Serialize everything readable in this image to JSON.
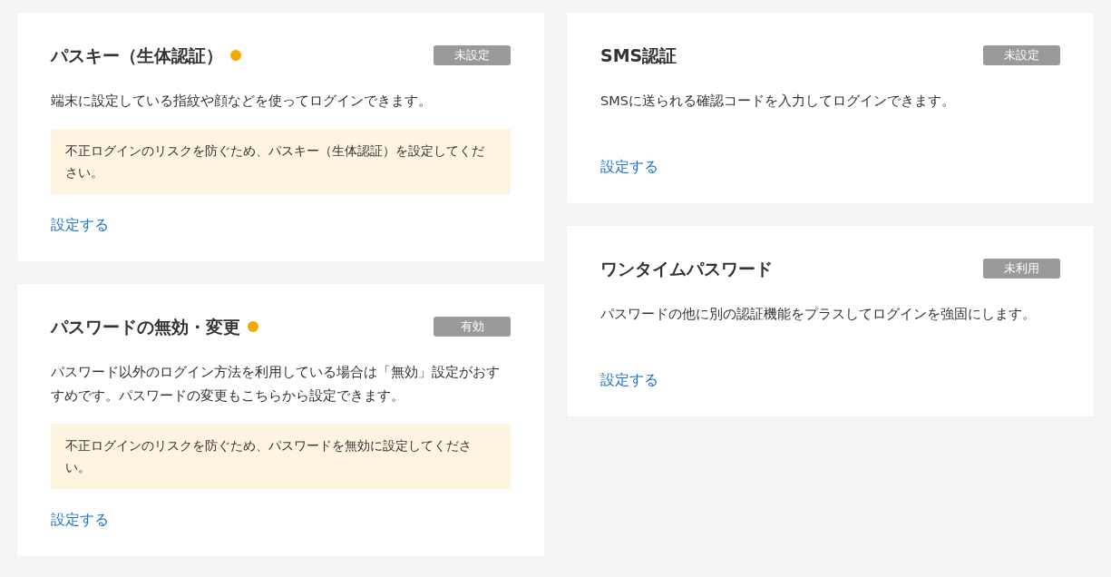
{
  "columns": [
    {
      "cards": [
        {
          "title": "パスキー（生体認証）",
          "attention": true,
          "status": "未設定",
          "description": "端末に設定している指紋や顔などを使ってログインできます。",
          "warning": "不正ログインのリスクを防ぐため、パスキー（生体認証）を設定してください。",
          "link": "設定する"
        },
        {
          "title": "パスワードの無効・変更",
          "attention": true,
          "status": "有効",
          "description": "パスワード以外のログイン方法を利用している場合は「無効」設定がおすすめです。パスワードの変更もこちらから設定できます。",
          "warning": "不正ログインのリスクを防ぐため、パスワードを無効に設定してください。",
          "link": "設定する"
        }
      ]
    },
    {
      "cards": [
        {
          "title": "SMS認証",
          "attention": false,
          "status": "未設定",
          "description": "SMSに送られる確認コードを入力してログインできます。",
          "link": "設定する"
        },
        {
          "title": "ワンタイムパスワード",
          "attention": false,
          "status": "未利用",
          "description": "パスワードの他に別の認証機能をプラスしてログインを強固にします。",
          "link": "設定する"
        }
      ]
    }
  ]
}
